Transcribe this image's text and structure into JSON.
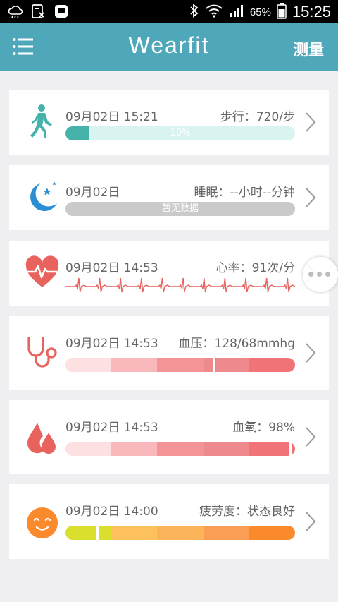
{
  "status_bar": {
    "battery_percent": "65%",
    "time": "15:25",
    "icons": [
      "cloud-icon",
      "sim-icon",
      "notification-app-icon",
      "bluetooth-icon",
      "wifi-icon",
      "signal-icon",
      "battery-icon"
    ]
  },
  "app_bar": {
    "title": "Wearfit",
    "measure_label": "测量",
    "color": "#4ea8ba"
  },
  "cards": {
    "steps": {
      "icon": "walking-person-icon",
      "date": "09月02日 15:21",
      "metric": "步行：720/步",
      "progress_label": "10%",
      "progress": 0.1,
      "color": "#45b3aa"
    },
    "sleep": {
      "icon": "moon-stars-icon",
      "date": "09月02日",
      "metric": "睡眠：--小时--分钟",
      "bar_label": "暂无数据",
      "color": "#2b8fd5"
    },
    "heart": {
      "icon": "heart-pulse-icon",
      "date": "09月02日 14:53",
      "metric": "心率：91次/分",
      "color": "#e8625e"
    },
    "blood_pressure": {
      "icon": "stethoscope-icon",
      "date": "09月02日 14:53",
      "metric": "血压：128/68mmhg",
      "level": 0.65,
      "segment_colors": [
        "#fde0e1",
        "#f9b8bb",
        "#f59497",
        "#ee8a8d",
        "#f07477"
      ]
    },
    "blood_oxygen": {
      "icon": "blood-drops-icon",
      "date": "09月02日 14:53",
      "metric": "血氧：98%",
      "level": 0.98,
      "segment_colors": [
        "#fde0e1",
        "#f9b8bb",
        "#f59497",
        "#ee8a8d",
        "#f07477"
      ]
    },
    "fatigue": {
      "icon": "smiley-face-icon",
      "date": "09月02日 14:00",
      "metric": "疲劳度：状态良好",
      "level": 0.14,
      "segment_colors": [
        "#d9df2c",
        "#fcc15a",
        "#fcb45b",
        "#fb9e55",
        "#fb8a2c"
      ]
    }
  }
}
